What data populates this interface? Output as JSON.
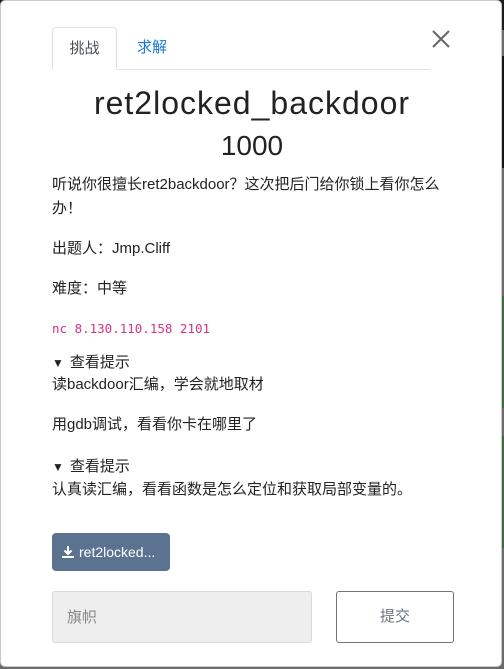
{
  "tabs": {
    "challenge": "挑战",
    "solves": "求解"
  },
  "challenge": {
    "name": "ret2locked_backdoor",
    "value": "1000",
    "description": "听说你很擅长ret2backdoor？这次把后门给你锁上看你怎么办！",
    "author": "出题人：Jmp.Cliff",
    "difficulty": "难度：中等",
    "connection": "nc 8.130.110.158 2101"
  },
  "hints": [
    {
      "summary": "查看提示",
      "lines": [
        "读backdoor汇编，学会就地取材",
        "用gdb调试，看看你卡在哪里了"
      ]
    },
    {
      "summary": "查看提示",
      "lines": [
        "认真读汇编，看看函数是怎么定位和获取局部变量的。"
      ]
    }
  ],
  "download": {
    "label": "ret2locked..."
  },
  "form": {
    "placeholder": "旗帜",
    "submit": "提交"
  },
  "icons": {
    "close": "close-icon",
    "download": "download-icon",
    "caret": "caret-down-icon"
  },
  "colors": {
    "accent": "#1976d2",
    "download_bg": "#5b7391",
    "code": "#d63384"
  }
}
